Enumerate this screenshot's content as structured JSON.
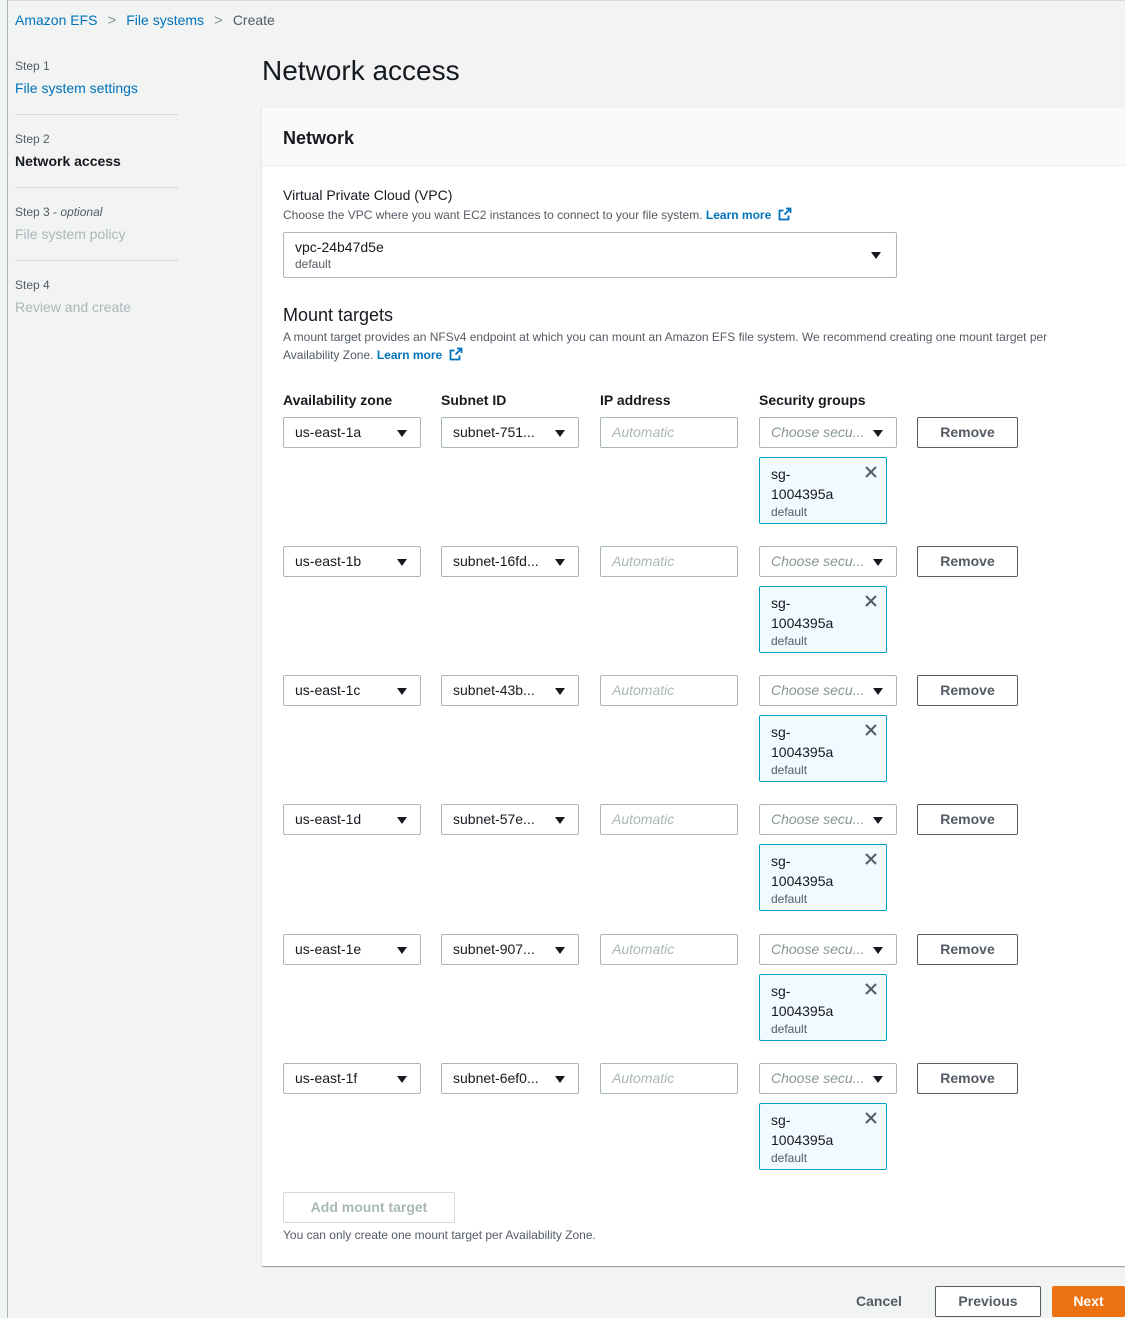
{
  "breadcrumb": {
    "items": [
      "Amazon EFS",
      "File systems"
    ],
    "current": "Create"
  },
  "steps": [
    {
      "num": "Step 1",
      "label": "File system settings"
    },
    {
      "num": "Step 2",
      "label": "Network access"
    },
    {
      "num": "Step 3",
      "optional": "optional",
      "label": "File system policy"
    },
    {
      "num": "Step 4",
      "label": "Review and create"
    }
  ],
  "page_title": "Network access",
  "network": {
    "header": "Network",
    "vpc_label": "Virtual Private Cloud (VPC)",
    "vpc_desc": "Choose the VPC where you want EC2 instances to connect to your file system.",
    "learn_more": "Learn more",
    "vpc_value": "vpc-24b47d5e",
    "vpc_sub": "default"
  },
  "mount_targets": {
    "title": "Mount targets",
    "desc_line1": "A mount target provides an NFSv4 endpoint at which you can mount an Amazon EFS file system. We recommend creating one mount target per",
    "desc_line2": "Availability Zone.",
    "learn_more": "Learn more",
    "columns": {
      "az": "Availability zone",
      "subnet": "Subnet ID",
      "ip": "IP address",
      "sg": "Security groups"
    },
    "ip_placeholder": "Automatic",
    "sg_placeholder": "Choose secu...",
    "remove_label": "Remove",
    "rows": [
      {
        "az": "us-east-1a",
        "subnet": "subnet-751...",
        "sg_id": "sg-1004395a",
        "sg_sub": "default"
      },
      {
        "az": "us-east-1b",
        "subnet": "subnet-16fd...",
        "sg_id": "sg-1004395a",
        "sg_sub": "default"
      },
      {
        "az": "us-east-1c",
        "subnet": "subnet-43b...",
        "sg_id": "sg-1004395a",
        "sg_sub": "default"
      },
      {
        "az": "us-east-1d",
        "subnet": "subnet-57e...",
        "sg_id": "sg-1004395a",
        "sg_sub": "default"
      },
      {
        "az": "us-east-1e",
        "subnet": "subnet-907...",
        "sg_id": "sg-1004395a",
        "sg_sub": "default"
      },
      {
        "az": "us-east-1f",
        "subnet": "subnet-6ef0...",
        "sg_id": "sg-1004395a",
        "sg_sub": "default"
      }
    ],
    "add_label": "Add mount target",
    "add_note": "You can only create one mount target per Availability Zone."
  },
  "footer": {
    "cancel": "Cancel",
    "previous": "Previous",
    "next": "Next"
  },
  "colors": {
    "link": "#0073bb",
    "primary": "#ec7211",
    "token_bg": "#f1faff",
    "token_border": "#00a1c9"
  },
  "icons": {
    "external_link": "external-link-icon",
    "caret": "caret-down-icon",
    "close": "close-icon"
  }
}
